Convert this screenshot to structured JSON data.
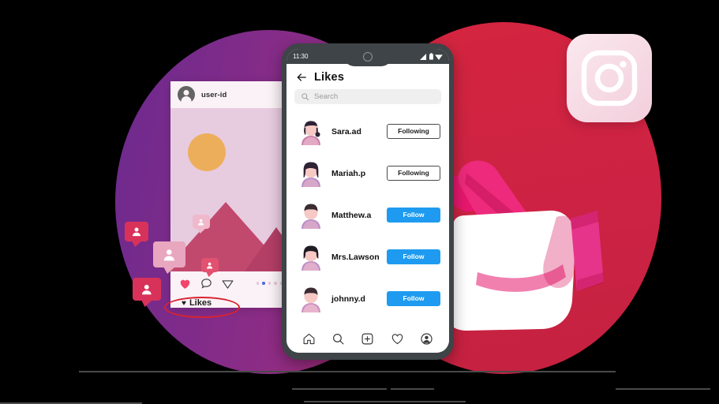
{
  "colors": {
    "blob_purple": "#7B2D8E",
    "blob_red": "#CC2244",
    "follow_blue": "#1E9BF0",
    "highlight_red": "#D8232F",
    "pink_heart": "#F2436B",
    "hand_pink": "#E6176E"
  },
  "instagram_logo": {
    "icon": "instagram-logo-icon"
  },
  "post_card": {
    "user_id": "user-id",
    "actions": [
      {
        "icon": "heart-icon"
      },
      {
        "icon": "comment-icon"
      },
      {
        "icon": "share-icon"
      }
    ],
    "carousel_dots": 5,
    "carousel_active_index": 1,
    "likes_label": "Likes",
    "likes_heart": "♥"
  },
  "notification_badges": [
    {
      "icon": "person-badge-icon",
      "color": "#D8325B"
    },
    {
      "icon": "person-badge-icon",
      "color": "#E8A7BE"
    },
    {
      "icon": "person-badge-icon",
      "color": "#F0B9CB"
    },
    {
      "icon": "person-badge-icon",
      "color": "#E2516F"
    },
    {
      "icon": "person-badge-icon",
      "color": "#D8325B"
    }
  ],
  "phone": {
    "status_bar": {
      "time": "11:30",
      "icons": [
        "signal-icon",
        "battery-icon",
        "wifi-icon"
      ]
    },
    "header": {
      "back_icon": "back-arrow-icon",
      "title": "Likes"
    },
    "search": {
      "icon": "search-icon",
      "placeholder": "Search"
    },
    "users": [
      {
        "name": "Sara.ad",
        "action": "Following",
        "state": "following",
        "avatar": "avatar-female-ponytail"
      },
      {
        "name": "Mariah.p",
        "action": "Following",
        "state": "following",
        "avatar": "avatar-female-long-hair"
      },
      {
        "name": "Matthew.a",
        "action": "Follow",
        "state": "follow",
        "avatar": "avatar-male-short-hair"
      },
      {
        "name": "Mrs.Lawson",
        "action": "Follow",
        "state": "follow",
        "avatar": "avatar-female-bob"
      },
      {
        "name": "johnny.d",
        "action": "Follow",
        "state": "follow",
        "avatar": "avatar-male-short-hair"
      }
    ],
    "tabbar": [
      {
        "icon": "home-icon"
      },
      {
        "icon": "search-icon"
      },
      {
        "icon": "add-post-icon"
      },
      {
        "icon": "heart-icon"
      },
      {
        "icon": "profile-icon"
      }
    ]
  }
}
